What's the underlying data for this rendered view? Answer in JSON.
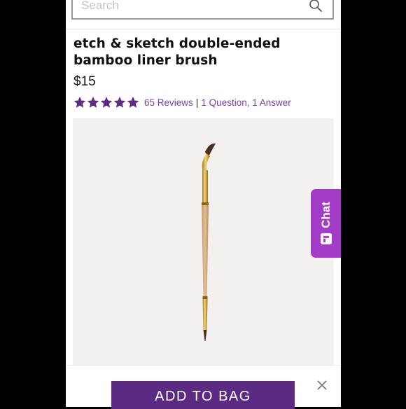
{
  "search": {
    "placeholder": "Search"
  },
  "product": {
    "title": "etch & sketch double-ended bamboo liner brush",
    "price": "$15",
    "rating": {
      "stars": 5,
      "max": 5,
      "reviews_label": "65 Reviews",
      "separator": "|",
      "qa_label": "1 Question, 1 Answer"
    }
  },
  "chat": {
    "label": "Chat"
  },
  "bottom": {
    "add_label": "ADD TO BAG"
  },
  "colors": {
    "accent": "#5b2a83",
    "link": "#7b3ea6",
    "chat": "#a23cc7",
    "image_bg": "#f3f0f0"
  },
  "icons": [
    "search-icon",
    "star-icon",
    "close-icon",
    "chat-icon"
  ]
}
